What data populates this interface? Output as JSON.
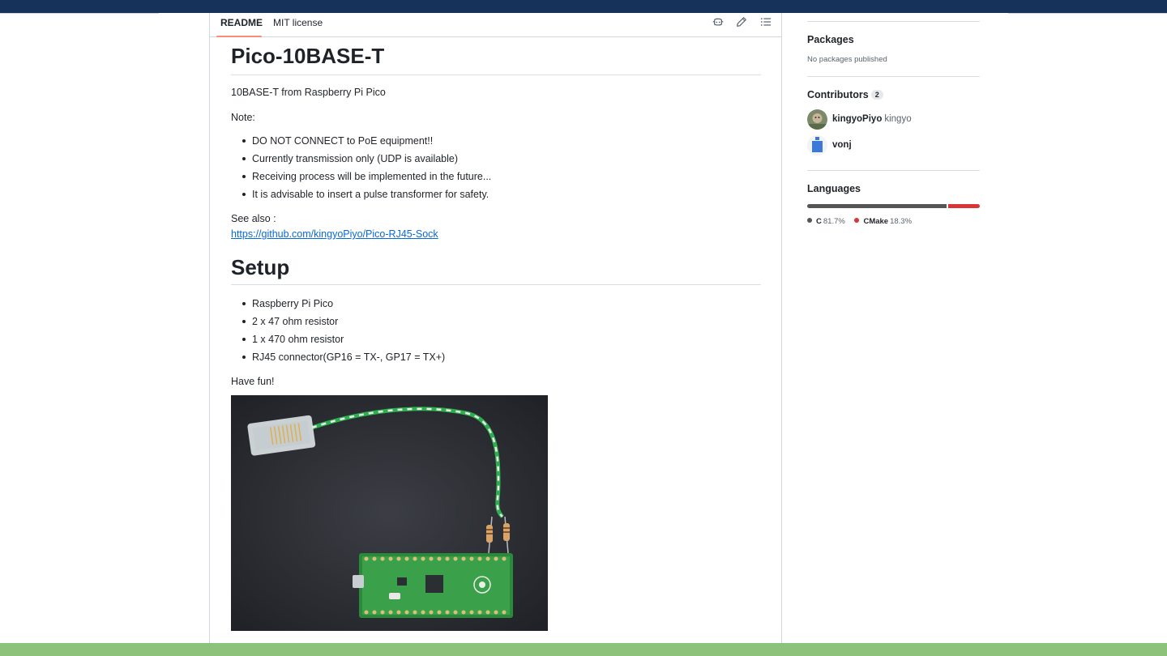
{
  "tabs": {
    "readme_label": "README",
    "license_label": "MIT license"
  },
  "toolbar": {
    "copilot_icon": "copilot-icon",
    "edit_icon": "pencil-icon",
    "outline_icon": "list-icon"
  },
  "readme": {
    "title": "Pico-10BASE-T",
    "description": "10BASE-T from Raspberry Pi Pico",
    "note_label": "Note:",
    "notes": [
      "DO NOT CONNECT to PoE equipment!!",
      "Currently transmission only (UDP is available)",
      "Receiving process will be implemented in the future...",
      "It is advisable to insert a pulse transformer for safety."
    ],
    "see_also_label": "See also :",
    "see_also_link": "https://github.com/kingyoPiyo/Pico-RJ45-Sock",
    "setup_heading": "Setup",
    "setup_items": [
      "Raspberry Pi Pico",
      "2 x 47 ohm resistor",
      "1 x 470 ohm resistor",
      "RJ45 connector(GP16 = TX-, GP17 = TX+)"
    ],
    "closing": "Have fun!"
  },
  "sidebar": {
    "packages": {
      "heading": "Packages",
      "empty_text": "No packages published"
    },
    "contributors": {
      "heading": "Contributors",
      "count": "2",
      "people": [
        {
          "login": "kingyoPiyo",
          "name": "kingyo"
        },
        {
          "login": "vonj",
          "name": ""
        }
      ]
    },
    "languages": {
      "heading": "Languages",
      "items": [
        {
          "name": "C",
          "percent": "81.7%",
          "value": 81.7,
          "color": "#555555"
        },
        {
          "name": "CMake",
          "percent": "18.3%",
          "value": 18.3,
          "color": "#DA3434"
        }
      ]
    }
  },
  "colors": {
    "accent_underline": "#fd8c73",
    "link": "#0969da",
    "header_band": "#16315a",
    "footer_band": "#8dc27a"
  }
}
